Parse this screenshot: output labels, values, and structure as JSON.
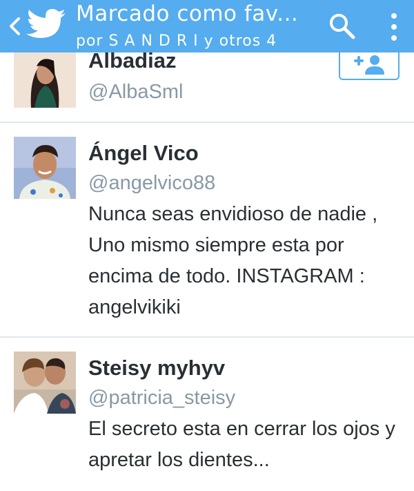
{
  "header": {
    "title": "Marcado como fav...",
    "subtitle": "por S A N D R I y otros 4",
    "icons": [
      "back-chevron-icon",
      "twitter-bird-icon",
      "search-icon",
      "overflow-menu-icon"
    ],
    "color": "#55acee"
  },
  "users": [
    {
      "name": "Albadiaz",
      "handle": "@AlbaSml",
      "bio": "",
      "follow_icon": "add-user-icon"
    },
    {
      "name": "Ángel Vico",
      "handle": "@angelvico88",
      "bio": "Nunca seas envidioso de nadie , Uno mismo siempre esta por encima de todo. INSTAGRAM : angelvikiki"
    },
    {
      "name": "Steisy myhyv",
      "handle": "@patricia_steisy",
      "bio": "El secreto esta en cerrar los ojos y apretar los dientes..."
    }
  ],
  "colors": {
    "accent": "#55acee",
    "text": "#292f33",
    "secondary": "#8899a6",
    "divider": "#e1e8ed"
  }
}
